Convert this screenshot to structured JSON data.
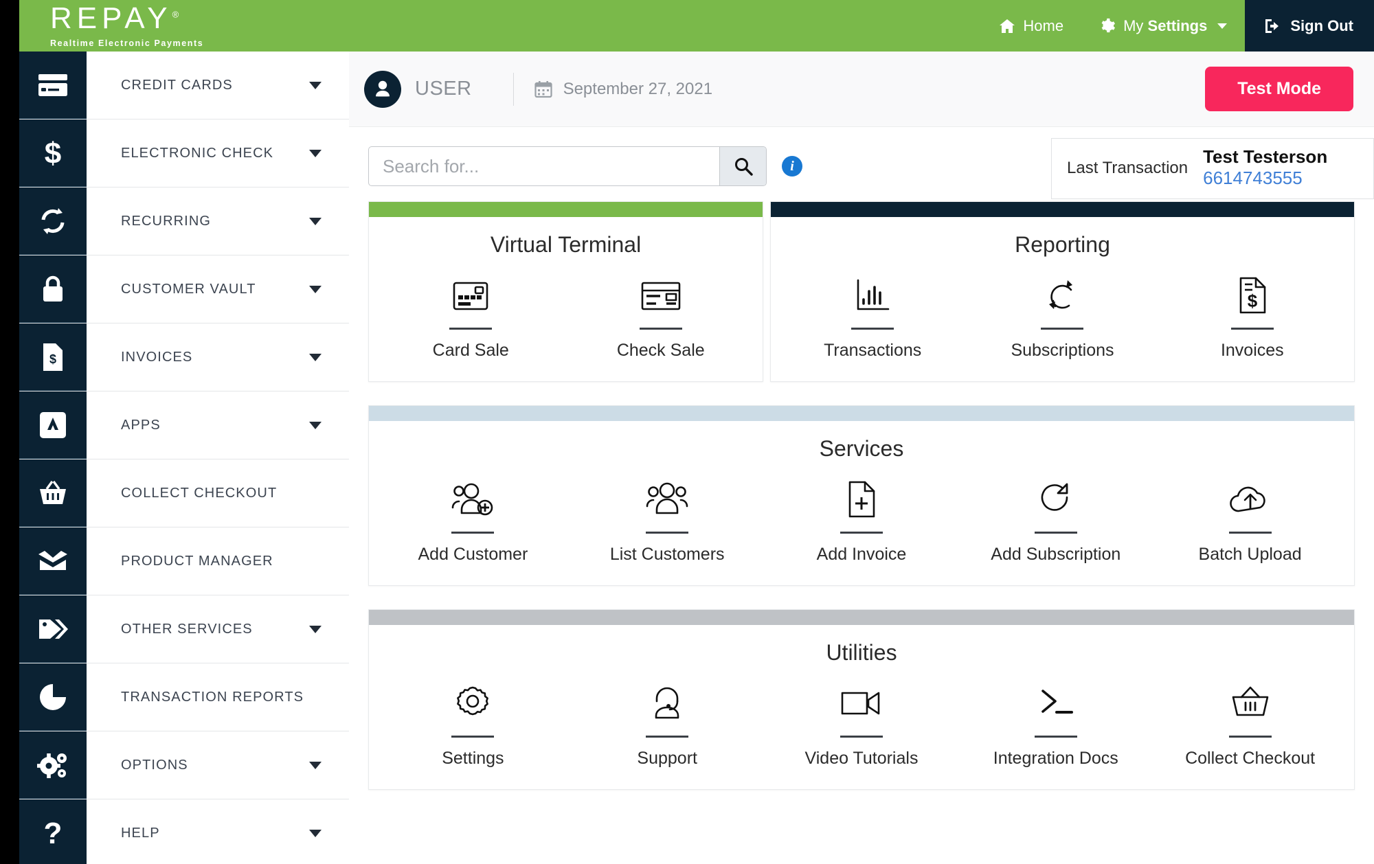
{
  "brand": {
    "logo_text": "REPAY",
    "logo_trademark": "®",
    "tagline": "Realtime Electronic Payments",
    "green": "#7ab94a",
    "navy": "#0b2233",
    "accent_pink": "#f8275c",
    "link_blue": "#3f7fd6"
  },
  "topnav": {
    "home": "Home",
    "settings_light": "My ",
    "settings_bold": "Settings",
    "sign_out": "Sign Out"
  },
  "sidebar": {
    "items": [
      {
        "label": "CREDIT CARDS",
        "icon": "credit-card-icon",
        "caret": true
      },
      {
        "label": "ELECTRONIC CHECK",
        "icon": "dollar-sign-icon",
        "caret": true
      },
      {
        "label": "RECURRING",
        "icon": "recurring-arrows-icon",
        "caret": true
      },
      {
        "label": "CUSTOMER VAULT",
        "icon": "lock-icon",
        "caret": true
      },
      {
        "label": "INVOICES",
        "icon": "invoice-doc-icon",
        "caret": true
      },
      {
        "label": "APPS",
        "icon": "apps-grid-icon",
        "caret": true
      },
      {
        "label": "COLLECT CHECKOUT",
        "icon": "basket-icon",
        "caret": false
      },
      {
        "label": "PRODUCT MANAGER",
        "icon": "open-box-icon",
        "caret": false
      },
      {
        "label": "OTHER SERVICES",
        "icon": "tags-icon",
        "caret": true
      },
      {
        "label": "TRANSACTION REPORTS",
        "icon": "pie-chart-icon",
        "caret": false
      },
      {
        "label": "OPTIONS",
        "icon": "gears-icon",
        "caret": true
      },
      {
        "label": "HELP",
        "icon": "question-mark-icon",
        "caret": true
      }
    ]
  },
  "header": {
    "user_label": "USER",
    "date": "September 27, 2021",
    "test_mode_button": "Test Mode"
  },
  "search": {
    "placeholder": "Search for...",
    "value": "",
    "search_icon": "magnifier-icon",
    "info_icon": "info-circle-icon"
  },
  "last_transaction": {
    "label": "Last Transaction",
    "name": "Test Testerson",
    "number": "6614743555"
  },
  "sections": [
    {
      "id": "virtual-terminal",
      "title": "Virtual Terminal",
      "bar_color": "green",
      "tiles": [
        {
          "label": "Card Sale",
          "icon": "credit-card-icon"
        },
        {
          "label": "Check Sale",
          "icon": "check-icon"
        }
      ]
    },
    {
      "id": "reporting",
      "title": "Reporting",
      "bar_color": "navy",
      "tiles": [
        {
          "label": "Transactions",
          "icon": "bar-chart-icon"
        },
        {
          "label": "Subscriptions",
          "icon": "recurring-arrows-icon"
        },
        {
          "label": "Invoices",
          "icon": "invoice-dollar-icon"
        }
      ]
    },
    {
      "id": "services",
      "title": "Services",
      "bar_color": "blue",
      "tiles": [
        {
          "label": "Add Customer",
          "icon": "user-plus-icon"
        },
        {
          "label": "List Customers",
          "icon": "users-group-icon"
        },
        {
          "label": "Add Invoice",
          "icon": "file-plus-icon"
        },
        {
          "label": "Add Subscription",
          "icon": "refresh-arrow-icon"
        },
        {
          "label": "Batch Upload",
          "icon": "cloud-upload-icon"
        }
      ]
    },
    {
      "id": "utilities",
      "title": "Utilities",
      "bar_color": "gray",
      "tiles": [
        {
          "label": "Settings",
          "icon": "gear-icon"
        },
        {
          "label": "Support",
          "icon": "headset-agent-icon"
        },
        {
          "label": "Video Tutorials",
          "icon": "video-camera-icon"
        },
        {
          "label": "Integration Docs",
          "icon": "terminal-prompt-icon"
        },
        {
          "label": "Collect Checkout",
          "icon": "basket-icon"
        }
      ]
    }
  ]
}
